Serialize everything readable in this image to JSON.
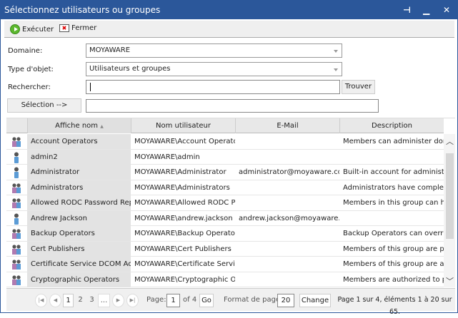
{
  "window": {
    "title": "Sélectionnez utilisateurs ou groupes",
    "accent": "#2b579a"
  },
  "toolbar": {
    "execute": "Exécuter",
    "close": "Fermer"
  },
  "form": {
    "domain_label": "Domaine:",
    "domain_value": "MOYAWARE",
    "type_label": "Type d'objet:",
    "type_value": "Utilisateurs et groupes",
    "search_label": "Rechercher:",
    "search_value": "",
    "find": "Trouver",
    "selection_button": "Sélection -->",
    "selection_value": ""
  },
  "grid": {
    "columns": [
      "Affiche nom",
      "Nom utilisateur",
      "E-Mail",
      "Description"
    ],
    "rows": [
      {
        "type": "group",
        "name": "Account Operators",
        "user": "MOYAWARE\\Account Operators",
        "email": "",
        "desc": "Members can administer domain"
      },
      {
        "type": "user",
        "name": "admin2",
        "user": "MOYAWARE\\admin",
        "email": "",
        "desc": ""
      },
      {
        "type": "user",
        "name": "Administrator",
        "user": "MOYAWARE\\Administrator",
        "email": "administrator@moyaware.com",
        "desc": "Built-in account for administering"
      },
      {
        "type": "group",
        "name": "Administrators",
        "user": "MOYAWARE\\Administrators",
        "email": "",
        "desc": "Administrators have complete and"
      },
      {
        "type": "group",
        "name": "Allowed RODC Password Replication Group",
        "user": "MOYAWARE\\Allowed RODC Password",
        "email": "",
        "desc": "Members in this group can have"
      },
      {
        "type": "user",
        "name": "Andrew Jackson",
        "user": "MOYAWARE\\andrew.jackson",
        "email": "andrew.jackson@moyaware.com",
        "desc": ""
      },
      {
        "type": "group",
        "name": "Backup Operators",
        "user": "MOYAWARE\\Backup Operators",
        "email": "",
        "desc": "Backup Operators can override s"
      },
      {
        "type": "group",
        "name": "Cert Publishers",
        "user": "MOYAWARE\\Cert Publishers",
        "email": "",
        "desc": "Members of this group are perm"
      },
      {
        "type": "group",
        "name": "Certificate Service DCOM Access",
        "user": "MOYAWARE\\Certificate Service DCOM",
        "email": "",
        "desc": "Members of this group are allow"
      },
      {
        "type": "group",
        "name": "Cryptographic Operators",
        "user": "MOYAWARE\\Cryptographic Operators",
        "email": "",
        "desc": "Members are authorized to perf"
      }
    ]
  },
  "pager": {
    "pages": [
      "1",
      "2",
      "3",
      "..."
    ],
    "page_label": "Page:",
    "page_value": "1",
    "of": "of 4",
    "go": "Go",
    "size_label": "Format de page:",
    "size_value": "20",
    "change": "Change",
    "summary": "Page 1 sur 4, éléments 1 à 20 sur 65."
  }
}
